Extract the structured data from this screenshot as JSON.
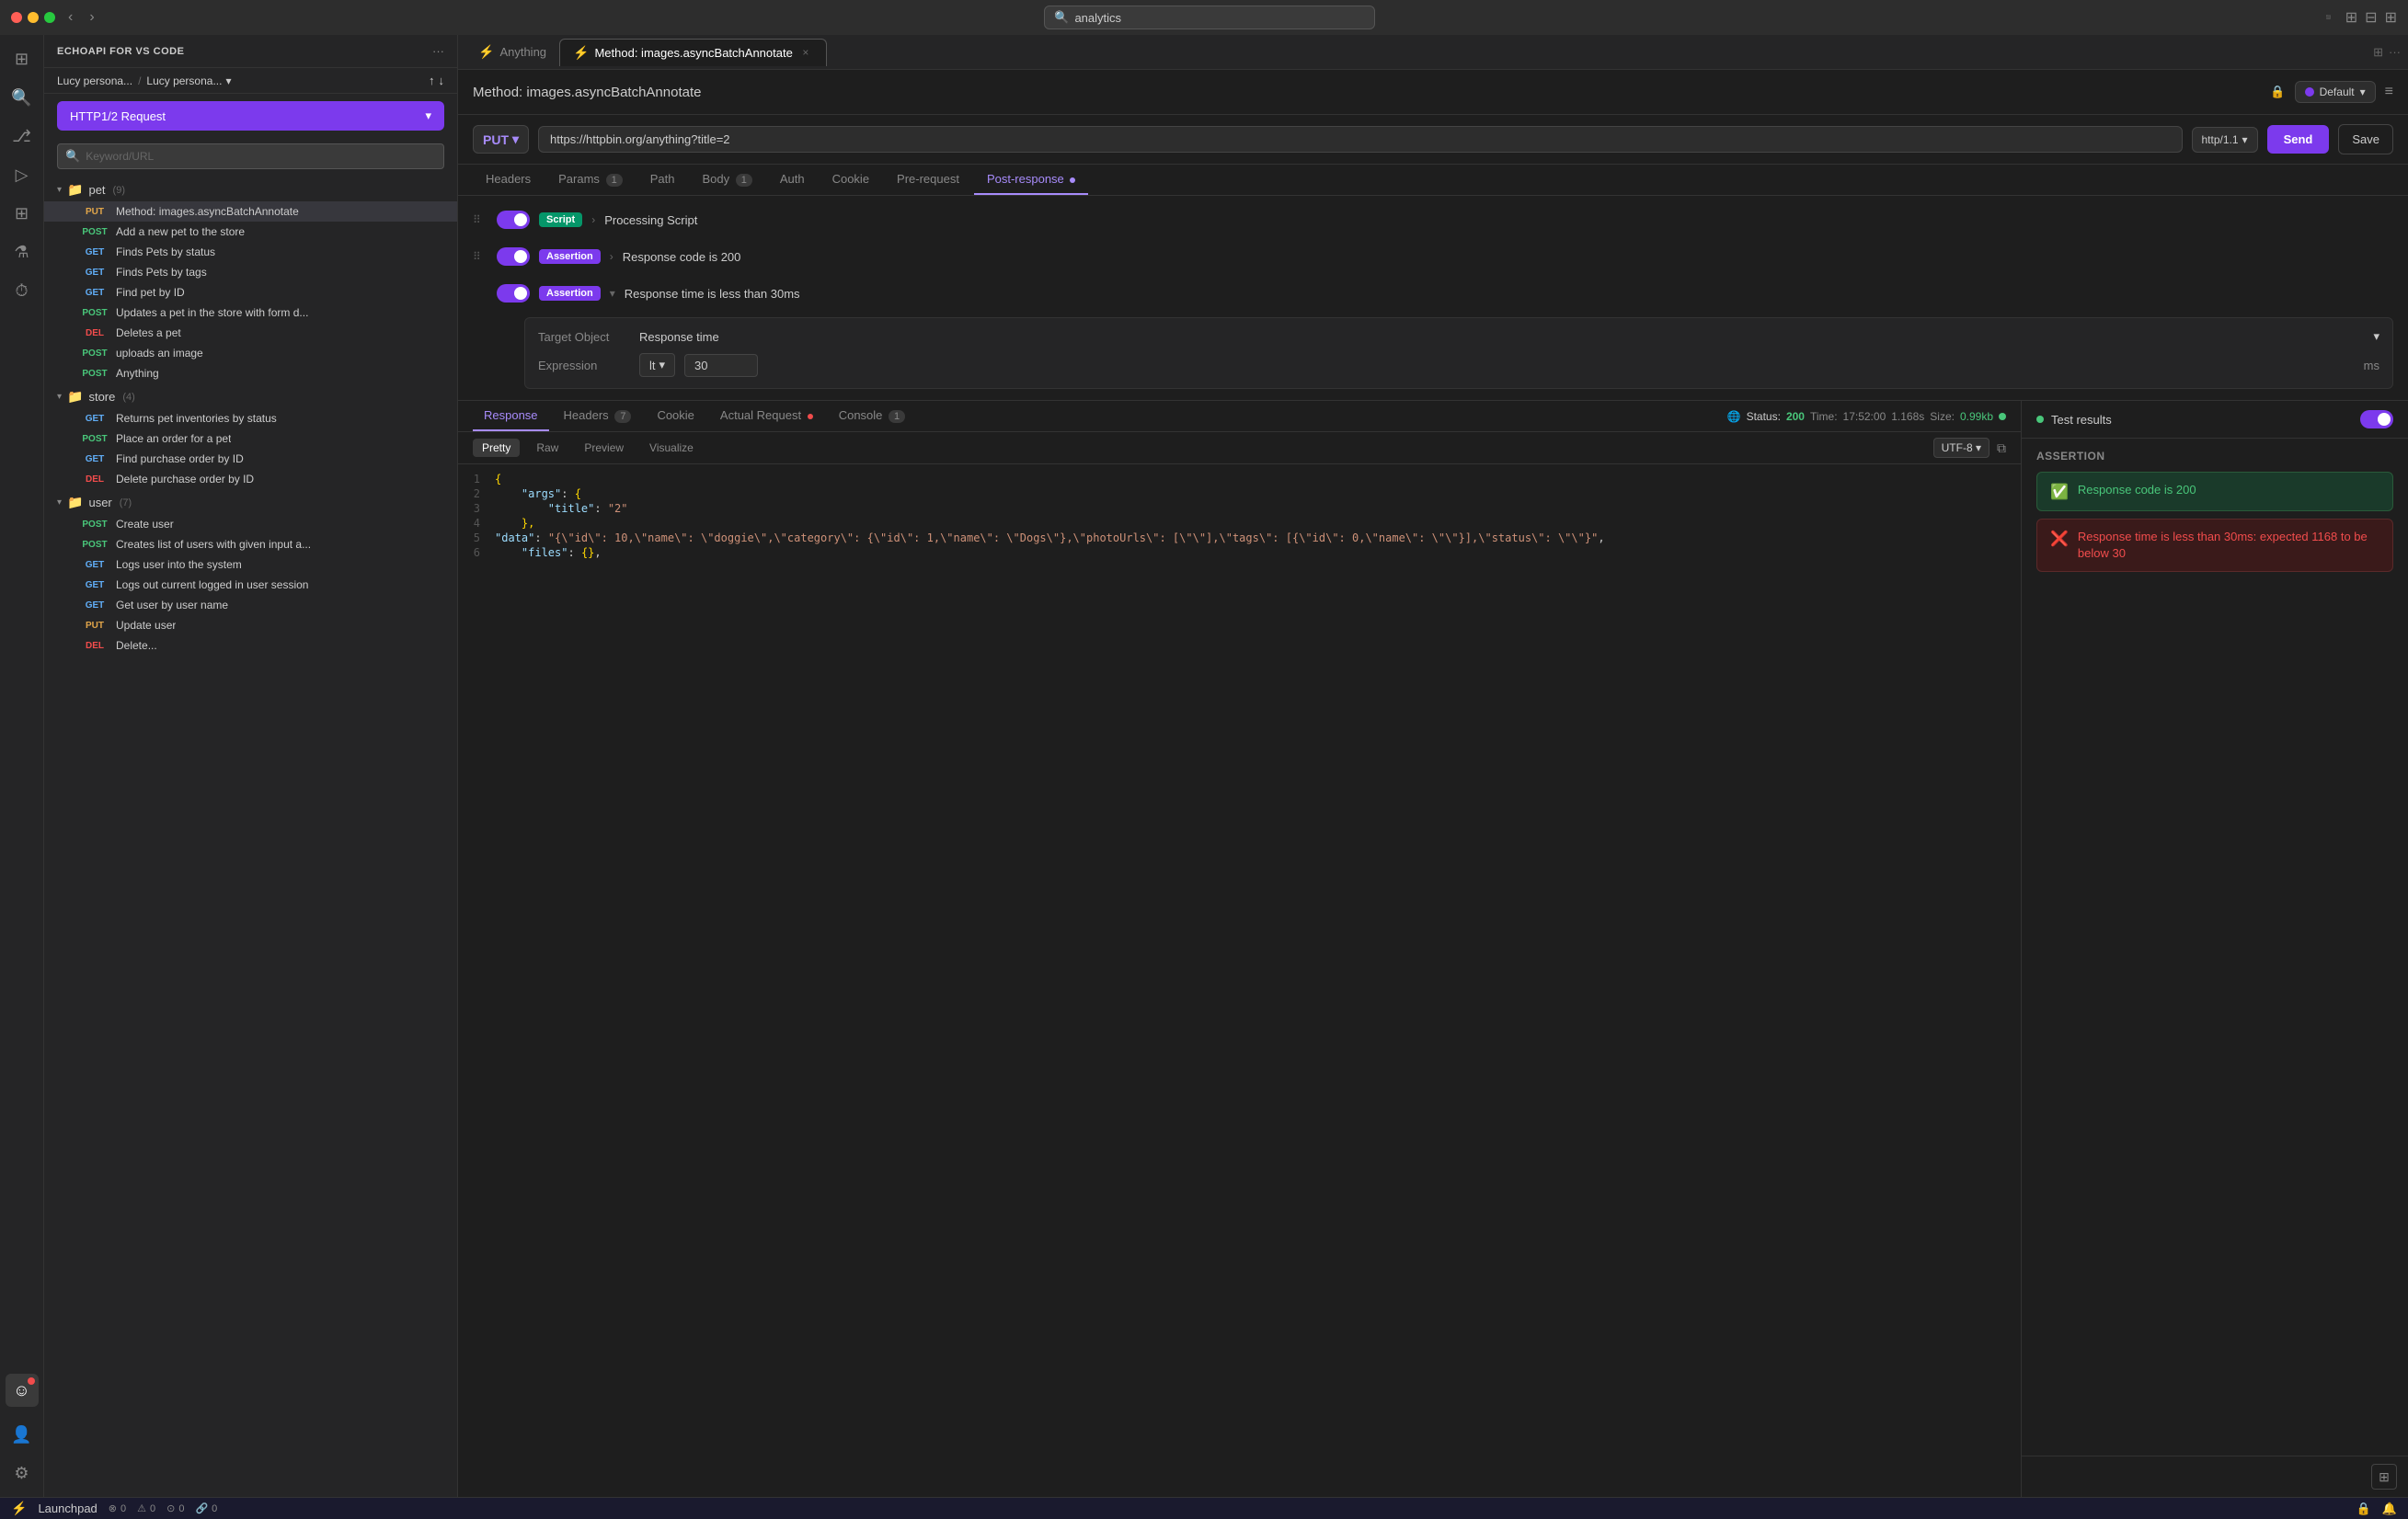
{
  "app": {
    "title": "analytics",
    "window_controls": {
      "red": "close",
      "yellow": "minimize",
      "green": "maximize"
    }
  },
  "sidebar": {
    "header_title": "ECHOAPI FOR VS CODE",
    "env": {
      "workspace": "Lucy persona...",
      "separator": "/",
      "env_label": "Lucy persona..."
    },
    "http_request_btn": "HTTP1/2 Request",
    "search_placeholder": "Keyword/URL",
    "groups": [
      {
        "id": "pet",
        "name": "pet",
        "count": "(9)",
        "expanded": true,
        "items": [
          {
            "method": "PUT",
            "label": "Method: images.asyncBatchAnnotate",
            "active": true
          },
          {
            "method": "POST",
            "label": "Add a new pet to the store"
          },
          {
            "method": "GET",
            "label": "Finds Pets by status"
          },
          {
            "method": "GET",
            "label": "Finds Pets by tags"
          },
          {
            "method": "GET",
            "label": "Find pet by ID"
          },
          {
            "method": "POST",
            "label": "Updates a pet in the store with form d..."
          },
          {
            "method": "DEL",
            "label": "Deletes a pet"
          },
          {
            "method": "POST",
            "label": "uploads an image"
          },
          {
            "method": "POST",
            "label": "Anything"
          }
        ]
      },
      {
        "id": "store",
        "name": "store",
        "count": "(4)",
        "expanded": true,
        "items": [
          {
            "method": "GET",
            "label": "Returns pet inventories by status"
          },
          {
            "method": "POST",
            "label": "Place an order for a pet"
          },
          {
            "method": "GET",
            "label": "Find purchase order by ID"
          },
          {
            "method": "DEL",
            "label": "Delete purchase order by ID"
          }
        ]
      },
      {
        "id": "user",
        "name": "user",
        "count": "(7)",
        "expanded": true,
        "items": [
          {
            "method": "POST",
            "label": "Create user"
          },
          {
            "method": "POST",
            "label": "Creates list of users with given input a..."
          },
          {
            "method": "GET",
            "label": "Logs user into the system"
          },
          {
            "method": "GET",
            "label": "Logs out current logged in user session"
          },
          {
            "method": "GET",
            "label": "Get user by user name"
          },
          {
            "method": "PUT",
            "label": "Update user"
          },
          {
            "method": "DEL",
            "label": "Delete..."
          }
        ]
      }
    ]
  },
  "tabs": [
    {
      "id": "anything",
      "label": "Anything",
      "icon": "⚡",
      "active": false,
      "closeable": false
    },
    {
      "id": "method-tab",
      "label": "Method: images.asyncBatchAnnotate",
      "icon": "⚡",
      "active": true,
      "closeable": true
    }
  ],
  "request": {
    "title": "Method: images.asyncBatchAnnotate",
    "env": {
      "label": "Default",
      "color": "#7c3aed"
    },
    "method": "PUT",
    "url": "https://httpbin.org/anything?title=2",
    "http_version": "http/1.1",
    "send_label": "Send",
    "save_label": "Save",
    "tabs": [
      {
        "id": "headers",
        "label": "Headers",
        "active": false
      },
      {
        "id": "params",
        "label": "Params",
        "badge": "1",
        "active": false
      },
      {
        "id": "path",
        "label": "Path",
        "active": false
      },
      {
        "id": "body",
        "label": "Body",
        "badge": "1",
        "active": false
      },
      {
        "id": "auth",
        "label": "Auth",
        "active": false
      },
      {
        "id": "cookie",
        "label": "Cookie",
        "active": false
      },
      {
        "id": "pre-request",
        "label": "Pre-request",
        "active": false
      },
      {
        "id": "post-response",
        "label": "Post-response",
        "active": true,
        "dot": true
      }
    ]
  },
  "post_response": {
    "rows": [
      {
        "id": "script",
        "enabled": true,
        "type_label": "Script",
        "type_class": "type-script",
        "label": "Processing Script",
        "expanded": false
      },
      {
        "id": "assertion-1",
        "enabled": true,
        "type_label": "Assertion",
        "type_class": "type-assertion",
        "label": "Response code is 200",
        "expanded": false
      },
      {
        "id": "assertion-2",
        "enabled": true,
        "type_label": "Assertion",
        "type_class": "type-assertion",
        "label": "Response time is less than 30ms",
        "expanded": true
      }
    ],
    "assertion_detail": {
      "target_label": "Target Object",
      "target_value": "Response time",
      "expression_label": "Expression",
      "expression_value": "lt",
      "number_value": "30",
      "unit": "ms"
    }
  },
  "response": {
    "tabs": [
      {
        "id": "response",
        "label": "Response",
        "active": true
      },
      {
        "id": "headers",
        "label": "Headers",
        "badge": "7"
      },
      {
        "id": "cookie",
        "label": "Cookie"
      },
      {
        "id": "actual-request",
        "label": "Actual Request",
        "dot": true
      },
      {
        "id": "console",
        "label": "Console",
        "badge": "1"
      }
    ],
    "status": {
      "label": "Status:",
      "code": "200",
      "time_label": "Time:",
      "time": "17:52:00",
      "duration": "1.168s",
      "size_label": "Size:",
      "size": "0.99kb"
    },
    "format_buttons": [
      {
        "id": "pretty",
        "label": "Pretty",
        "active": true
      },
      {
        "id": "raw",
        "label": "Raw",
        "active": false
      },
      {
        "id": "preview",
        "label": "Preview",
        "active": false
      },
      {
        "id": "visualize",
        "label": "Visualize",
        "active": false
      }
    ],
    "encoding": "UTF-8",
    "code_lines": [
      {
        "num": 1,
        "content": "{"
      },
      {
        "num": 2,
        "content": "    \"args\": {"
      },
      {
        "num": 3,
        "content": "        \"title\": \"2\""
      },
      {
        "num": 4,
        "content": "    },"
      },
      {
        "num": 5,
        "content": "    \"data\": \"{\\n\\t\\\"id\\\": 10,\\n\\t\\\"name\\\":\\n\\t\\\"doggie\\\",\\n\\t\\\"category\\\": {\\n\\t\\t\\\"id\\\": 1,\\n\\t\\t\\\"name\\\": \\\"Dogs\\\"\\n\\t},\\n\\t\\\"photoUrls\\\": [\\n\\t\\t\\\"\\\"\\n\\t],\\n\\t\\\"tags\\\": [\\n\\t\\t{\\n\\t\\t\\t\\\"id\\\": 0,\\n\\t\\t\\t\\\"name\\\": \\\"\\\"\\n\\t\\t}\\n\\t],\\n\\t\\\"status\\\": \\\"\\\"\\n}\","
      },
      {
        "num": 6,
        "content": "    \"files\": {},"
      }
    ]
  },
  "test_results": {
    "enabled": true,
    "label": "Test results",
    "section_title": "Assertion",
    "items": [
      {
        "id": "result-1",
        "type": "pass",
        "icon": "✅",
        "text": "Response code is 200"
      },
      {
        "id": "result-2",
        "type": "fail",
        "icon": "❌",
        "text": "Response time is less than 30ms: expected 1168 to be below 30"
      }
    ]
  },
  "status_bar": {
    "logo": "⚡",
    "app_label": "Launchpad",
    "items": [
      {
        "id": "errors",
        "icon": "⊗",
        "value": "0"
      },
      {
        "id": "warnings",
        "icon": "⚠",
        "value": "0"
      },
      {
        "id": "info",
        "icon": "ℹ",
        "value": "0"
      },
      {
        "id": "debug",
        "icon": "🔗",
        "value": "0"
      }
    ]
  },
  "icons": {
    "chevron_down": "▾",
    "chevron_right": "›",
    "folder": "📁",
    "search": "🔍",
    "drag": "⠿",
    "copy": "⧉",
    "close": "×",
    "dots": "···",
    "cloud_upload": "↑",
    "cloud_download": "↓",
    "globe": "🌐"
  }
}
